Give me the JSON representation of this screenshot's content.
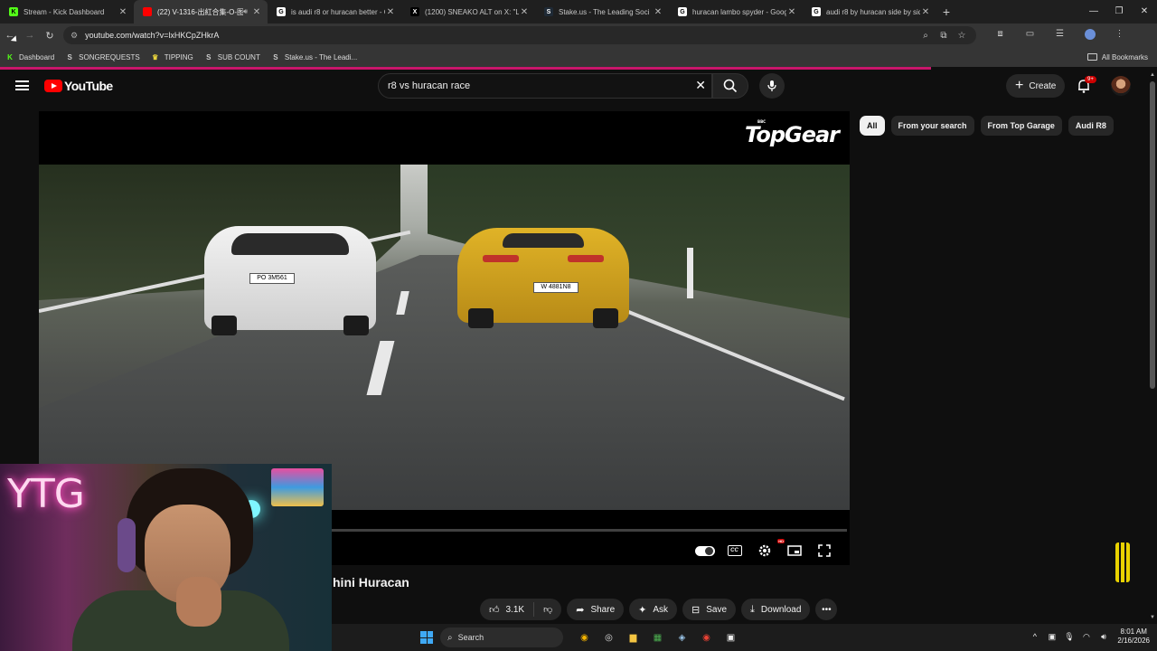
{
  "browser": {
    "tabs": [
      {
        "title": "Stream - Kick Dashboard",
        "favicon_color": "#53fc18",
        "favicon_glyph": "K",
        "active": false
      },
      {
        "title": "(22) V-1316-出紅合集-O-图",
        "favicon_color": "#ff0000",
        "favicon_glyph": "",
        "active": true,
        "audio": true
      },
      {
        "title": "is audi r8 or huracan better - G",
        "favicon_color": "#ffffff",
        "favicon_glyph": "G",
        "active": false
      },
      {
        "title": "(1200) SNEAKO ALT on X: \"LLL",
        "favicon_color": "#000000",
        "favicon_glyph": "X",
        "active": false
      },
      {
        "title": "Stake.us - The Leading Soci",
        "favicon_color": "#1f2a36",
        "favicon_glyph": "S",
        "active": false
      },
      {
        "title": "huracan lambo spyder - Googl",
        "favicon_color": "#ffffff",
        "favicon_glyph": "G",
        "active": false
      },
      {
        "title": "audi r8 by huracan side by side",
        "favicon_color": "#ffffff",
        "favicon_glyph": "G",
        "active": false
      }
    ],
    "url": "youtube.com/watch?v=lxHKCpZHkrA",
    "bookmarks": [
      {
        "label": "Dashboard",
        "icon": "kick-icon",
        "color": "#53fc18",
        "glyph": "K"
      },
      {
        "label": "SONGREQUESTS",
        "icon": "stake-icon",
        "color": "#cccccc",
        "glyph": "S"
      },
      {
        "label": "TIPPING",
        "icon": "crown-icon",
        "color": "#e8d33c",
        "glyph": "♛"
      },
      {
        "label": "SUB COUNT",
        "icon": "stake-icon",
        "color": "#cccccc",
        "glyph": "S"
      },
      {
        "label": "Stake.us - The Leadi...",
        "icon": "stake-icon",
        "color": "#cccccc",
        "glyph": "S"
      }
    ],
    "all_bookmarks": "All Bookmarks"
  },
  "youtube": {
    "logo_text": "YouTube",
    "search_query": "r8 vs huracan race",
    "create_label": "Create",
    "notification_badge": "9+",
    "chips": [
      {
        "label": "All",
        "active": true
      },
      {
        "label": "From your search",
        "active": false
      },
      {
        "label": "From Top Garage",
        "active": false
      },
      {
        "label": "Audi R8",
        "active": false
      }
    ],
    "video": {
      "watermark": "TopGear",
      "watermark_small": "BBC",
      "plate_white": "PO 3M561",
      "plate_yellow": "W 4881N8",
      "title_visible": "hini Huracan"
    },
    "actions": {
      "like_count": "3.1K",
      "share": "Share",
      "ask": "Ask",
      "save": "Save",
      "download": "Download"
    }
  },
  "webcam": {
    "neon_text": "YTG"
  },
  "taskbar": {
    "search_label": "Search",
    "time": "8:01 AM",
    "date": "2/16/2026"
  },
  "colors": {
    "yt_red": "#ff0000",
    "accent_pink": "#c8166b",
    "bg": "#0f0f0f"
  }
}
